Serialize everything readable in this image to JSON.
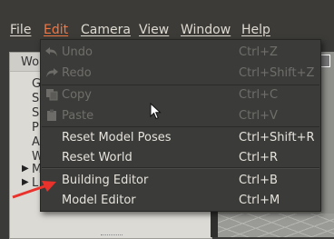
{
  "menubar": {
    "items": [
      {
        "label": "File"
      },
      {
        "label": "Edit"
      },
      {
        "label": "Camera"
      },
      {
        "label": "View"
      },
      {
        "label": "Window"
      },
      {
        "label": "Help"
      }
    ]
  },
  "left_panel": {
    "title_fragment": "Wo",
    "tree_letters": [
      "G",
      "S",
      "S",
      "P",
      "A",
      "W",
      "M",
      "L"
    ]
  },
  "edit_menu": {
    "items": [
      {
        "label": "Undo",
        "shortcut": "Ctrl+Z",
        "enabled": false,
        "icon": "undo-icon"
      },
      {
        "label": "Redo",
        "shortcut": "Ctrl+Shift+Z",
        "enabled": false,
        "icon": "redo-icon"
      },
      {
        "label": "Copy",
        "shortcut": "Ctrl+C",
        "enabled": false,
        "icon": "copy-icon"
      },
      {
        "label": "Paste",
        "shortcut": "Ctrl+V",
        "enabled": false,
        "icon": "paste-icon"
      },
      {
        "label": "Reset Model Poses",
        "shortcut": "Ctrl+Shift+R",
        "enabled": true
      },
      {
        "label": "Reset World",
        "shortcut": "Ctrl+R",
        "enabled": true
      },
      {
        "label": "Building Editor",
        "shortcut": "Ctrl+B",
        "enabled": true
      },
      {
        "label": "Model Editor",
        "shortcut": "Ctrl+M",
        "enabled": true
      }
    ]
  },
  "colors": {
    "accent": "#f07746",
    "menu_bg": "#3b3b39",
    "annotation_arrow": "#e8322b"
  }
}
